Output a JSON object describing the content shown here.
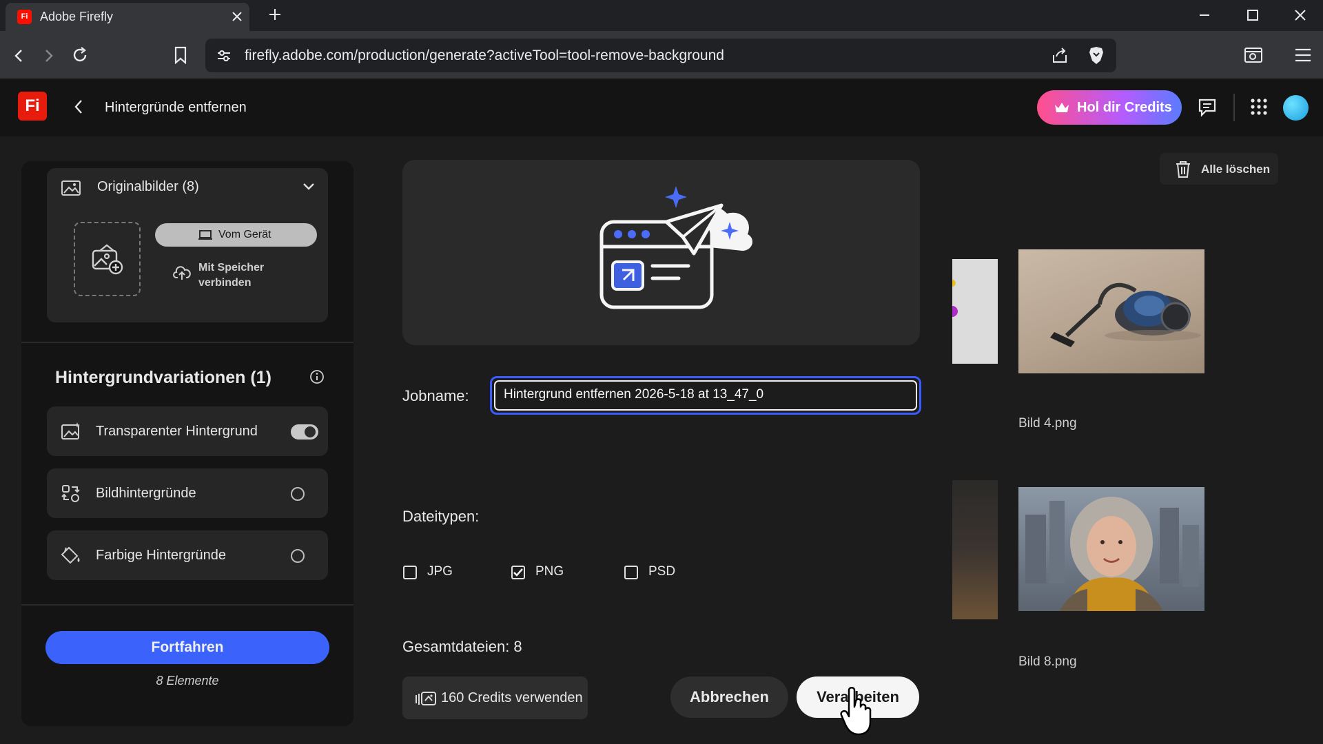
{
  "browser": {
    "tab_title": "Adobe Firefly",
    "favicon_text": "Fi",
    "url": "firefly.adobe.com/production/generate?activeTool=tool-remove-background"
  },
  "header": {
    "logo_text": "Fi",
    "title": "Hintergründe entfernen",
    "credits_button": "Hol dir Credits"
  },
  "left_panel": {
    "originals_label": "Originalbilder (8)",
    "device_button": "Vom Gerät",
    "storage_link": "Mit Speicher verbinden",
    "variations_title": "Hintergrundvariationen (1)",
    "options": [
      {
        "label": "Transparenter Hintergrund",
        "enabled": true
      },
      {
        "label": "Bildhintergründe",
        "enabled": false
      },
      {
        "label": "Farbige Hintergründe",
        "enabled": false
      }
    ],
    "continue_button": "Fortfahren",
    "elements_count": "8 Elemente"
  },
  "center": {
    "jobname_label": "Jobname:",
    "jobname_value": "Hintergrund entfernen 2026-5-18 at 13_47_0",
    "filetypes_label": "Dateitypen:",
    "filetypes": [
      {
        "label": "JPG",
        "checked": false
      },
      {
        "label": "PNG",
        "checked": true
      },
      {
        "label": "PSD",
        "checked": false
      }
    ],
    "total_files": "Gesamtdateien: 8",
    "credits_use_button": "160 Credits verwenden",
    "cancel_button": "Abbrechen",
    "process_button": "Verarbeiten"
  },
  "gallery": {
    "clear_all_button": "Alle löschen",
    "items": [
      {
        "caption": "Bild 4.png",
        "icon": "vacuum-cleaner-image"
      },
      {
        "caption": "Bild 8.png",
        "icon": "woman-portrait-image"
      }
    ]
  },
  "colors": {
    "accent_blue": "#3b63fb",
    "brand_red": "#e81c0d",
    "background": "#1c1c1c"
  }
}
